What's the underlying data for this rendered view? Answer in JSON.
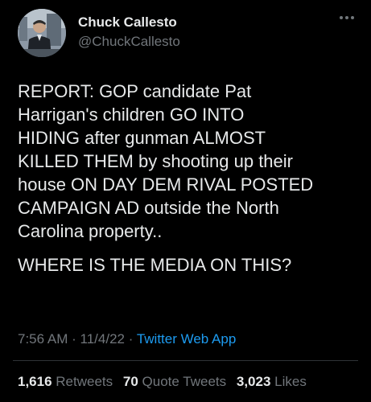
{
  "author": {
    "name": "Chuck Callesto",
    "handle": "@ChuckCallesto"
  },
  "more_icon": "more-horizontal-icon",
  "tweet": {
    "paragraphs": [
      "REPORT: GOP candidate Pat\nHarrigan's children GO INTO\nHIDING after gunman ALMOST\nKILLED THEM by shooting up their\nhouse ON DAY DEM RIVAL POSTED\nCAMPAIGN AD outside the North\nCarolina property..",
      "WHERE IS THE MEDIA ON THIS?"
    ]
  },
  "meta": {
    "time": "7:56 AM",
    "date": "11/4/22",
    "separator": "·",
    "source": "Twitter Web App"
  },
  "stats": {
    "retweets_count": "1,616",
    "retweets_label": "Retweets",
    "quotes_count": "70",
    "quotes_label": "Quote Tweets",
    "likes_count": "3,023",
    "likes_label": "Likes"
  },
  "colors": {
    "background": "#000000",
    "text": "#e7e9ea",
    "muted": "#71767b",
    "link": "#1d9bf0",
    "divider": "#2f3336"
  }
}
